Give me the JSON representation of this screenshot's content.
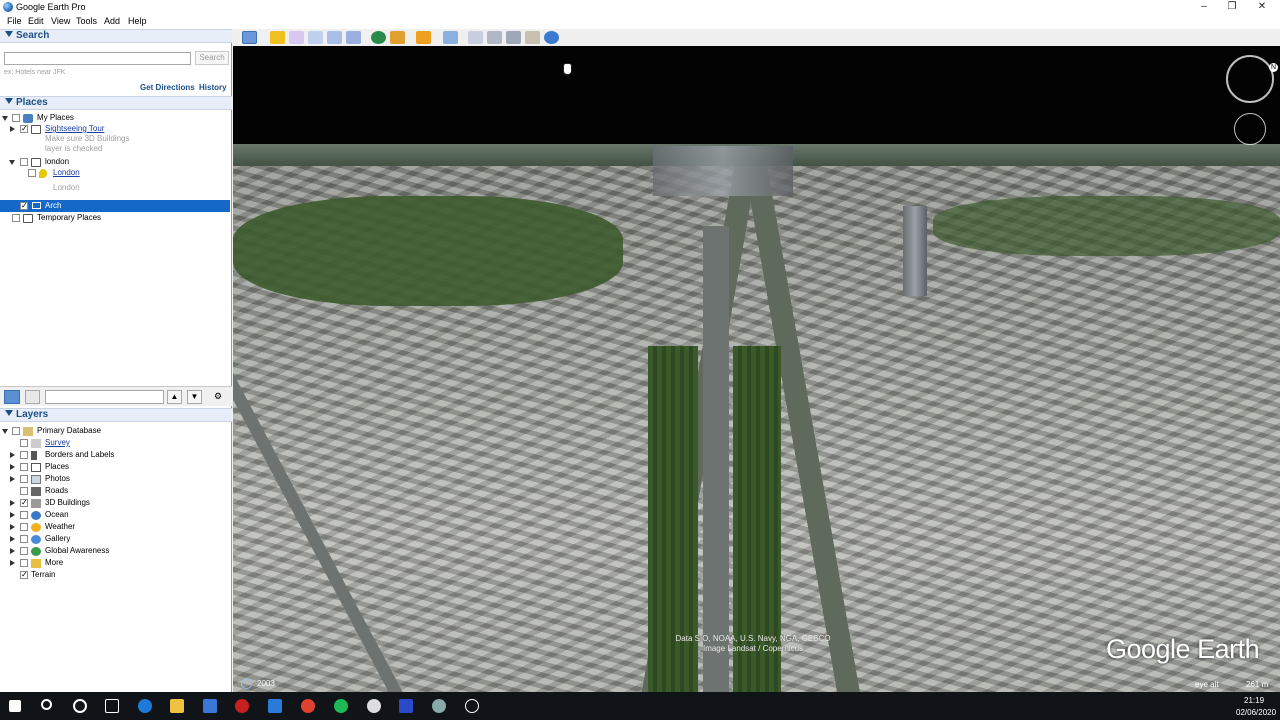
{
  "window": {
    "title": "Google Earth Pro",
    "minimize": "–",
    "maximize": "❐",
    "close": "✕"
  },
  "menu": [
    "File",
    "Edit",
    "View",
    "Tools",
    "Add",
    "Help"
  ],
  "search": {
    "header": "Search",
    "placeholder": "",
    "button": "Search",
    "hint": "ex: Hotels near JFK",
    "get_directions": "Get Directions",
    "history": "History"
  },
  "places": {
    "header": "Places",
    "items": {
      "my_places": "My Places",
      "sightseeing_tour": "Sightseeing Tour",
      "note1": "Make sure 3D Buildings",
      "note2": "layer is checked",
      "london_folder": "london",
      "london_link": "London",
      "london_sub": "London",
      "arch": "Arch",
      "temporary": "Temporary Places"
    }
  },
  "layers": {
    "header": "Layers",
    "items": {
      "primary": "Primary Database",
      "survey": "Survey",
      "borders": "Borders and Labels",
      "places": "Places",
      "photos": "Photos",
      "roads": "Roads",
      "buildings": "3D Buildings",
      "ocean": "Ocean",
      "weather": "Weather",
      "gallery": "Gallery",
      "global": "Global Awareness",
      "more": "More",
      "terrain": "Terrain"
    }
  },
  "earth": {
    "attribution_line1": "Data SIO, NOAA, U.S. Navy, NGA, GEBCO",
    "attribution_line2": "Image Landsat / Copernicus",
    "logo": "Google Earth",
    "imagery_year": "2003",
    "eye_alt_label": "eye alt",
    "eye_alt_value": "261 m",
    "compass_n": "N"
  },
  "taskbar": {
    "time": "21:19",
    "date": "02/06/2020"
  },
  "colors": {
    "selection": "#1668c8",
    "link": "#1a3ea6",
    "header_text": "#1b4f8a"
  }
}
